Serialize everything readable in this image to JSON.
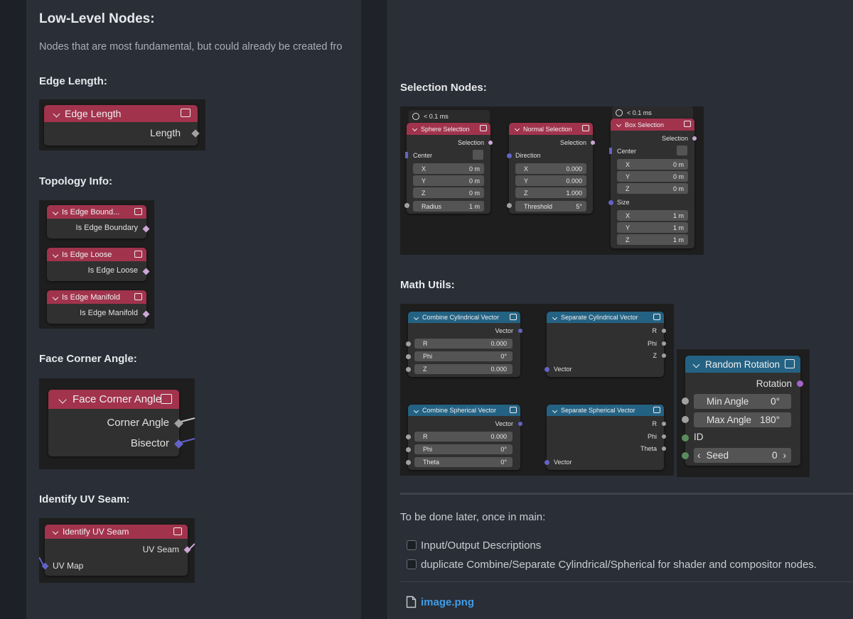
{
  "left": {
    "heading": "Low-Level Nodes:",
    "paragraph": "Nodes that are most fundamental, but could already be created fro",
    "sections": {
      "edge_length": "Edge Length:",
      "topology": "Topology Info:",
      "face_corner": "Face Corner Angle:",
      "uv_seam": "Identify UV Seam:"
    },
    "nodes": {
      "edge_length": {
        "title": "Edge Length",
        "output": "Length"
      },
      "is_edge_boundary": {
        "title": "Is Edge Bound...",
        "output": "Is Edge Boundary"
      },
      "is_edge_loose": {
        "title": "Is Edge Loose",
        "output": "Is Edge Loose"
      },
      "is_edge_manifold": {
        "title": "Is Edge Manifold",
        "output": "Is Edge Manifold"
      },
      "face_corner_angle": {
        "title": "Face Corner Angle",
        "out1": "Corner Angle",
        "out2": "Bisector"
      },
      "identify_uv_seam": {
        "title": "Identify UV Seam",
        "output": "UV Seam",
        "input": "UV Map"
      }
    }
  },
  "right": {
    "selection_heading": "Selection Nodes:",
    "sphere": {
      "timing": "< 0.1 ms",
      "title": "Sphere Selection",
      "output": "Selection",
      "center": "Center",
      "x": {
        "label": "X",
        "value": "0 m"
      },
      "y": {
        "label": "Y",
        "value": "0 m"
      },
      "z": {
        "label": "Z",
        "value": "0 m"
      },
      "radius": {
        "label": "Radius",
        "value": "1 m"
      }
    },
    "normal": {
      "title": "Normal Selection",
      "output": "Selection",
      "direction": "Direction",
      "x": {
        "label": "X",
        "value": "0.000"
      },
      "y": {
        "label": "Y",
        "value": "0.000"
      },
      "z": {
        "label": "Z",
        "value": "1.000"
      },
      "threshold": {
        "label": "Threshold",
        "value": "5°"
      }
    },
    "box": {
      "timing": "< 0.1 ms",
      "title": "Box Selection",
      "output": "Selection",
      "center": "Center",
      "cx": {
        "label": "X",
        "value": "0 m"
      },
      "cy": {
        "label": "Y",
        "value": "0 m"
      },
      "cz": {
        "label": "Z",
        "value": "0 m"
      },
      "size": "Size",
      "sx": {
        "label": "X",
        "value": "1 m"
      },
      "sy": {
        "label": "Y",
        "value": "1 m"
      },
      "sz": {
        "label": "Z",
        "value": "1 m"
      }
    },
    "math_heading": "Math Utils:",
    "comb_cyl": {
      "title": "Combine Cylindrical Vector",
      "output": "Vector",
      "r": {
        "label": "R",
        "value": "0.000"
      },
      "phi": {
        "label": "Phi",
        "value": "0°"
      },
      "z": {
        "label": "Z",
        "value": "0.000"
      }
    },
    "sep_cyl": {
      "title": "Separate Cylindrical Vector",
      "o1": "R",
      "o2": "Phi",
      "o3": "Z",
      "input": "Vector"
    },
    "comb_sph": {
      "title": "Combine Spherical Vector",
      "output": "Vector",
      "r": {
        "label": "R",
        "value": "0.000"
      },
      "phi": {
        "label": "Phi",
        "value": "0°"
      },
      "theta": {
        "label": "Theta",
        "value": "0°"
      }
    },
    "sep_sph": {
      "title": "Separate Spherical Vector",
      "o1": "R",
      "o2": "Phi",
      "o3": "Theta",
      "input": "Vector"
    },
    "random_rotation": {
      "title": "Random Rotation",
      "output": "Rotation",
      "min_angle": {
        "label": "Min Angle",
        "value": "0°"
      },
      "max_angle": {
        "label": "Max Angle",
        "value": "180°"
      },
      "id": "ID",
      "seed": {
        "label": "Seed",
        "value": "0"
      }
    },
    "todo_text": "To be done later, once in main:",
    "todo_items": [
      "Input/Output Descriptions",
      "duplicate Combine/Separate Cylindrical/Spherical for shader and compositor nodes."
    ],
    "attachment": "image.png"
  },
  "colors": {
    "node_header_red": "#a1334d",
    "node_header_blue": "#246283",
    "socket_vector": "#6363c7",
    "socket_float": "#a1a1a1",
    "socket_bool": "#cca6d6",
    "socket_int": "#598c5c",
    "socket_rotation": "#a663c7",
    "link": "#3d9de8"
  }
}
